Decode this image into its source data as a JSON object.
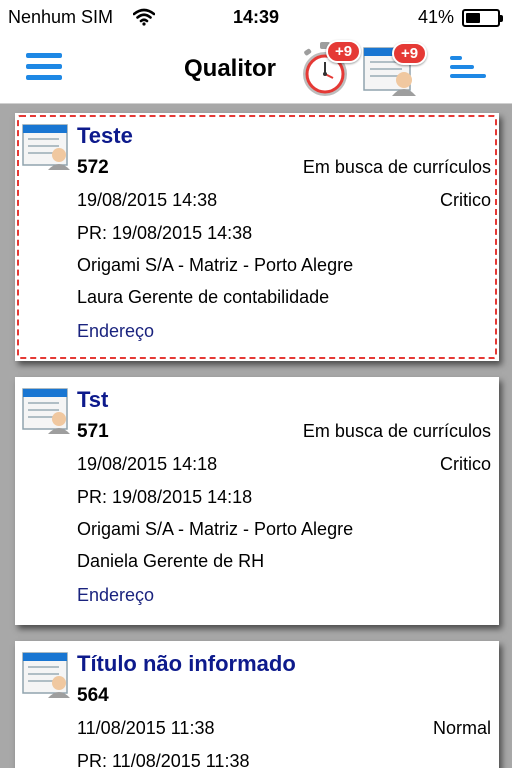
{
  "status_bar": {
    "carrier": "Nenhum SIM",
    "time": "14:39",
    "battery": "41%",
    "battery_level": 0.41
  },
  "nav": {
    "title": "Qualitor",
    "timer_badge": "+9",
    "list_badge": "+9"
  },
  "colors": {
    "accent": "#1e88e5",
    "title": "#0d1a8c",
    "badge": "#e53935",
    "selection": "#e53935"
  },
  "tickets": [
    {
      "title": "Teste",
      "number": "572",
      "status": "Em busca de currículos",
      "date": "19/08/2015 14:38",
      "priority": "Critico",
      "pr": "PR: 19/08/2015 14:38",
      "company": "Origami S/A - Matriz - Porto Alegre",
      "contact": "Laura Gerente de contabilidade",
      "link": "Endereço",
      "selected": true
    },
    {
      "title": "Tst",
      "number": "571",
      "status": "Em busca de currículos",
      "date": "19/08/2015 14:18",
      "priority": "Critico",
      "pr": "PR: 19/08/2015 14:18",
      "company": "Origami S/A - Matriz - Porto Alegre",
      "contact": "Daniela Gerente de RH",
      "link": "Endereço",
      "selected": false
    },
    {
      "title": "Título não informado",
      "number": "564",
      "status": "",
      "date": "11/08/2015 11:38",
      "priority": "Normal",
      "pr": "PR: 11/08/2015 11:38",
      "company": "",
      "contact": "",
      "link": "",
      "selected": false
    }
  ]
}
